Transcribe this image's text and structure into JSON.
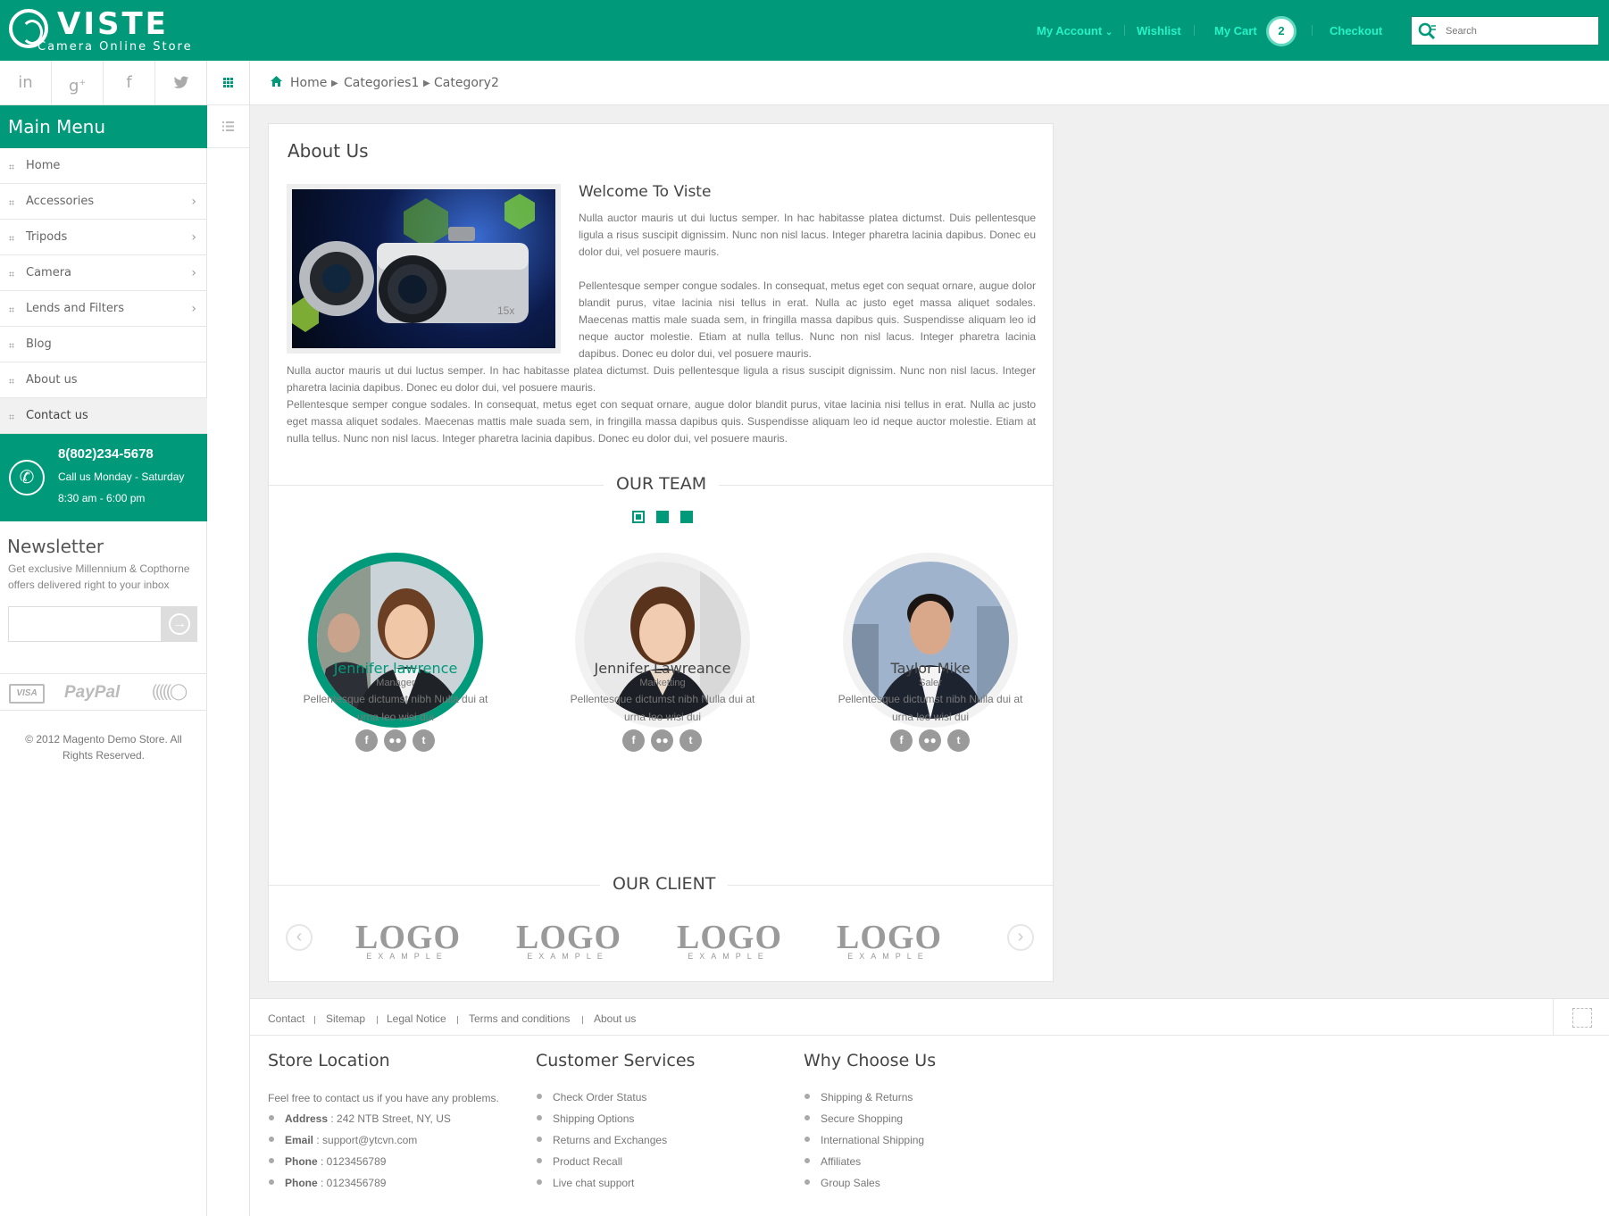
{
  "header": {
    "logo_text": "VISTE",
    "logo_tagline": "Camera Online Store",
    "nav": {
      "account": "My Account",
      "wishlist": "Wishlist",
      "cart": "My Cart",
      "cart_count": "2",
      "checkout": "Checkout"
    },
    "search_placeholder": "Search"
  },
  "colors": {
    "brand": "#009a7a",
    "nav_text": "#26f3c9",
    "muted_text": "#777777"
  },
  "social": [
    "in",
    "g+",
    "f",
    "twitter"
  ],
  "menu": {
    "title": "Main Menu",
    "items": [
      {
        "label": "Home",
        "has_sub": false
      },
      {
        "label": "Accessories",
        "has_sub": true
      },
      {
        "label": "Tripods",
        "has_sub": true
      },
      {
        "label": "Camera",
        "has_sub": true
      },
      {
        "label": "Lends and Filters",
        "has_sub": true
      },
      {
        "label": "Blog",
        "has_sub": false
      },
      {
        "label": "About us",
        "has_sub": false
      },
      {
        "label": "Contact us",
        "has_sub": false,
        "active": true
      }
    ]
  },
  "call": {
    "phone": "8(802)234-5678",
    "days": "Call us Monday - Saturday",
    "hours": "8:30 am - 6:00 pm"
  },
  "newsletter": {
    "title": "Newsletter",
    "text": "Get exclusive Millennium & Copthorne offers delivered right to your inbox"
  },
  "payments": {
    "visa": "VISA",
    "paypal": "PayPal"
  },
  "copyright": "© 2012 Magento Demo Store. All Rights Reserved.",
  "breadcrumb": [
    "Home",
    "Categories1",
    "Category2"
  ],
  "about": {
    "title": "About Us",
    "welcome": "Welcome To Viste",
    "p1": "Nulla auctor mauris ut dui luctus semper. In hac habitasse platea dictumst. Duis pellentesque ligula a risus suscipit dignissim. Nunc non nisl lacus. Integer pharetra lacinia dapibus. Donec eu dolor dui, vel posuere mauris.",
    "p2": "Pellentesque semper congue sodales. In consequat, metus eget con sequat ornare, augue dolor blandit purus, vitae lacinia nisi tellus in erat. Nulla ac justo eget massa aliquet sodales. Maecenas mattis male suada sem, in fringilla massa dapibus quis. Suspendisse aliquam leo id neque auctor molestie. Etiam at nulla tellus. Nunc non nisl lacus. Integer pharetra lacinia dapibus. Donec eu dolor dui, vel posuere mauris.",
    "p3": "Nulla auctor mauris ut dui luctus semper. In hac habitasse platea dictumst. Duis pellentesque ligula a risus suscipit dignissim. Nunc non nisl lacus. Integer pharetra lacinia dapibus. Donec eu dolor dui, vel posuere mauris.",
    "p4": "Pellentesque semper congue sodales. In consequat, metus eget con sequat ornare, augue dolor blandit purus, vitae lacinia nisi tellus in erat. Nulla ac justo eget massa aliquet sodales. Maecenas mattis male suada sem, in fringilla massa dapibus quis. Suspendisse aliquam leo id neque auctor molestie. Etiam at nulla tellus. Nunc non nisl lacus. Integer pharetra lacinia dapibus. Donec eu dolor dui, vel posuere mauris."
  },
  "team": {
    "title": "OUR TEAM",
    "members": [
      {
        "name": "Jennifer lawrence",
        "role": "Manager",
        "desc": "Pellentesque dictumst nibh Nulla dui at urna leo wisi dui"
      },
      {
        "name": "Jennifer Lawreance",
        "role": "Marketting",
        "desc": "Pellentesque dictumst nibh Nulla dui at urna leo wisi dui"
      },
      {
        "name": "Taylor Mike",
        "role": "Saler",
        "desc": "Pellentesque dictumst nibh Nulla dui at urna leo wisi dui"
      }
    ]
  },
  "clients": {
    "title": "OUR CLIENT",
    "logos": [
      {
        "big": "LOGO",
        "small": "EXAMPLE"
      },
      {
        "big": "LOGO",
        "small": "EXAMPLE"
      },
      {
        "big": "LOGO",
        "small": "EXAMPLE"
      },
      {
        "big": "LOGO",
        "small": "EXAMPLE"
      }
    ]
  },
  "footer": {
    "links": [
      "Contact",
      "Sitemap",
      "Legal Notice",
      "Terms and conditions",
      "About us"
    ],
    "store": {
      "title": "Store Location",
      "intro": "Feel free to contact us if you have any problems.",
      "address_label": "Address",
      "address": " : 242 NTB Street, NY, US",
      "email_label": "Email",
      "email": " : support@ytcvn.com",
      "phone_label": "Phone",
      "phone": " : 0123456789",
      "phone2_label": "Phone",
      "phone2": " : 0123456789"
    },
    "services": {
      "title": "Customer Services",
      "items": [
        "Check Order Status",
        "Shipping Options",
        "Returns and Exchanges",
        "Product Recall",
        "Live chat support"
      ]
    },
    "why": {
      "title": "Why Choose Us",
      "items": [
        "Shipping & Returns",
        "Secure Shopping",
        "International Shipping",
        "Affiliates",
        "Group Sales"
      ]
    }
  }
}
